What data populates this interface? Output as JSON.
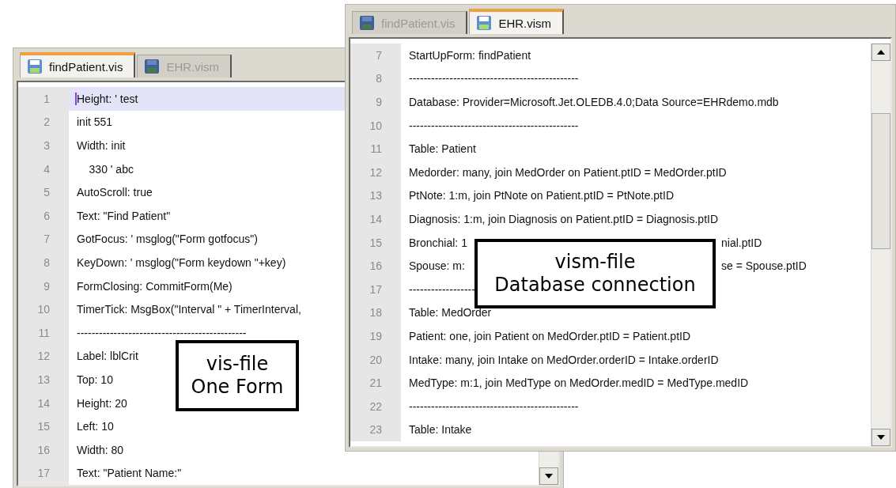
{
  "windows": [
    {
      "tabs": [
        {
          "label": "findPatient.vis",
          "selected": true
        },
        {
          "label": "EHR.vism",
          "selected": false
        }
      ],
      "lines": [
        {
          "number": "1",
          "text": "Height: ' test",
          "highlighted": true
        },
        {
          "number": "2",
          "text": "init 551",
          "highlighted": false
        },
        {
          "number": "3",
          "text": "Width: init",
          "highlighted": false
        },
        {
          "number": "4",
          "text": "    330 ' abc",
          "highlighted": false
        },
        {
          "number": "5",
          "text": "AutoScroll: true",
          "highlighted": false
        },
        {
          "number": "6",
          "text": "Text: \"Find Patient\"",
          "highlighted": false
        },
        {
          "number": "7",
          "text": "GotFocus: ' msglog(\"Form gotfocus\")",
          "highlighted": false
        },
        {
          "number": "8",
          "text": "KeyDown: ' msglog(\"Form keydown \"+key)",
          "highlighted": false
        },
        {
          "number": "9",
          "text": "FormClosing: CommitForm(Me)",
          "highlighted": false
        },
        {
          "number": "10",
          "text": "TimerTick: MsgBox(\"Interval \" + TimerInterval,",
          "highlighted": false
        },
        {
          "number": "11",
          "text": "----------------------------------------------",
          "highlighted": false
        },
        {
          "number": "12",
          "text": "Label: lblCrit",
          "highlighted": false
        },
        {
          "number": "13",
          "text": "Top: 10",
          "highlighted": false
        },
        {
          "number": "14",
          "text": "Height: 20",
          "highlighted": false
        },
        {
          "number": "15",
          "text": "Left: 10",
          "highlighted": false
        },
        {
          "number": "16",
          "text": "Width: 80",
          "highlighted": false
        },
        {
          "number": "17",
          "text": "Text: \"Patient Name:\"",
          "highlighted": false
        }
      ]
    },
    {
      "tabs": [
        {
          "label": "findPatient.vis",
          "selected": false
        },
        {
          "label": "EHR.vism",
          "selected": true
        }
      ],
      "lines": [
        {
          "number": "7",
          "text": "StartUpForm: findPatient",
          "highlighted": false
        },
        {
          "number": "8",
          "text": "----------------------------------------------",
          "highlighted": false
        },
        {
          "number": "9",
          "text": "Database: Provider=Microsoft.Jet.OLEDB.4.0;Data Source=EHRdemo.mdb",
          "highlighted": false
        },
        {
          "number": "10",
          "text": "----------------------------------------------",
          "highlighted": false
        },
        {
          "number": "11",
          "text": "Table: Patient",
          "highlighted": false
        },
        {
          "number": "12",
          "text": "Medorder: many, join MedOrder on Patient.ptID = MedOrder.ptID",
          "highlighted": false
        },
        {
          "number": "13",
          "text": "PtNote: 1:m, join PtNote on Patient.ptID = PtNote.ptID",
          "highlighted": false
        },
        {
          "number": "14",
          "text": "Diagnosis: 1:m, join Diagnosis on Patient.ptID = Diagnosis.ptID",
          "highlighted": false
        },
        {
          "number": "15",
          "parts": [
            "Bronchial: 1",
            "nial.ptID"
          ],
          "highlighted": false
        },
        {
          "number": "16",
          "parts": [
            "Spouse: m:",
            "se = Spouse.ptID"
          ],
          "highlighted": false
        },
        {
          "number": "17",
          "text": "------------------",
          "highlighted": false
        },
        {
          "number": "18",
          "text": "Table: MedOrder",
          "highlighted": false
        },
        {
          "number": "19",
          "text": "Patient: one, join Patient on MedOrder.ptID = Patient.ptID",
          "highlighted": false
        },
        {
          "number": "20",
          "text": "Intake: many, join Intake on MedOrder.orderID = Intake.orderID",
          "highlighted": false
        },
        {
          "number": "21",
          "text": "MedType: m:1, join MedType on MedOrder.medID = MedType.medID",
          "highlighted": false
        },
        {
          "number": "22",
          "text": "----------------------------------------------",
          "highlighted": false
        },
        {
          "number": "23",
          "text": "Table: Intake",
          "highlighted": false
        }
      ]
    }
  ],
  "callouts": [
    {
      "lines": [
        "vis-file",
        "One Form"
      ]
    },
    {
      "lines": [
        "vism-file",
        "Database connection"
      ]
    }
  ]
}
